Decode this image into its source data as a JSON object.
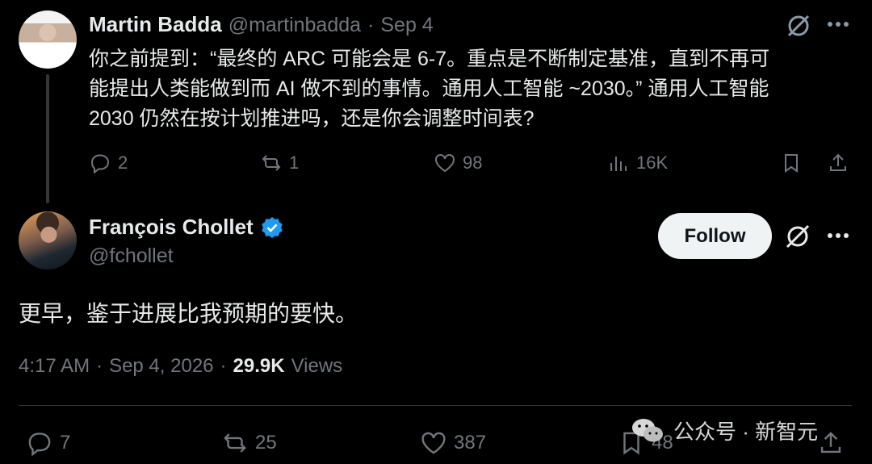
{
  "reply_tweet": {
    "author_name": "Martin Badda",
    "author_handle": "@martinbadda",
    "separator": "·",
    "date": "Sep 4",
    "text_line1": "你之前提到：“最终的 ARC 可能会是 6-7。重点是不断制定基准，直到不再可",
    "text_line2": "能提出人类能做到而 AI 做不到的事情。通用人工智能 ~2030。” 通用人工智能",
    "text_line3": "2030 仍然在按计划推进吗，还是你会调整时间表?",
    "replies": "2",
    "retweets": "1",
    "likes": "98",
    "views": "16K"
  },
  "main_tweet": {
    "author_name": "François Chollet",
    "author_handle": "@fchollet",
    "verified": true,
    "follow_label": "Follow",
    "text": "更早，鉴于进展比我预期的要快。",
    "time": "4:17 AM",
    "separator": "·",
    "date": "Sep 4, 2026",
    "separator2": "·",
    "views_count": "29.9K",
    "views_label": "Views",
    "replies": "7",
    "retweets": "25",
    "likes": "387",
    "bookmarks": "48"
  },
  "watermark": {
    "text": "公众号 · 新智元",
    "icon": "wechat-icon"
  },
  "colors": {
    "background": "#000000",
    "text": "#e7e9ea",
    "muted": "#71767b",
    "verified": "#1d9bf0",
    "follow_bg": "#eff3f4"
  }
}
